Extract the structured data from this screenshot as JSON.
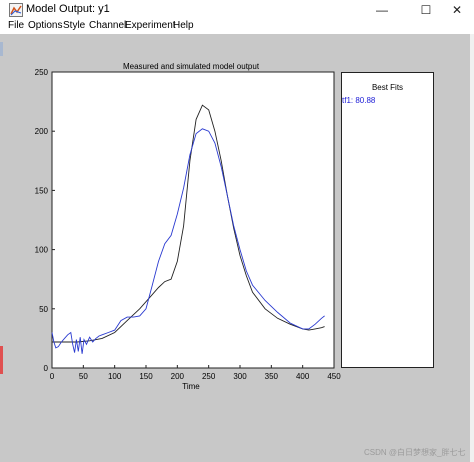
{
  "window": {
    "title": "Model Output: y1",
    "controls": {
      "minimize": "—",
      "maximize": "☐",
      "close": "✕"
    }
  },
  "menu": [
    "File",
    "Options",
    "Style",
    "Channel",
    "Experiment",
    "Help"
  ],
  "chart_data": {
    "type": "line",
    "title": "Measured and simulated model output",
    "xlabel": "Time",
    "ylabel": "",
    "xlim": [
      0,
      450
    ],
    "ylim": [
      0,
      250
    ],
    "xticks": [
      0,
      50,
      100,
      150,
      200,
      250,
      300,
      350,
      400,
      450
    ],
    "yticks": [
      0,
      50,
      100,
      150,
      200,
      250
    ],
    "grid": false,
    "series": [
      {
        "color": "#222222",
        "x": [
          0,
          20,
          40,
          60,
          80,
          100,
          120,
          140,
          160,
          170,
          180,
          190,
          200,
          210,
          220,
          230,
          240,
          250,
          260,
          270,
          280,
          290,
          300,
          310,
          320,
          340,
          360,
          380,
          400,
          410,
          420,
          430,
          435
        ],
        "y": [
          22,
          22,
          22,
          23,
          25,
          30,
          40,
          50,
          62,
          68,
          73,
          75,
          90,
          120,
          175,
          210,
          222,
          218,
          200,
          175,
          145,
          118,
          95,
          78,
          64,
          50,
          42,
          37,
          33,
          32,
          33,
          34,
          35
        ]
      },
      {
        "color": "#2a3ad0",
        "x": [
          0,
          3,
          6,
          10,
          15,
          20,
          25,
          30,
          33,
          36,
          39,
          42,
          45,
          48,
          51,
          55,
          60,
          65,
          70,
          75,
          80,
          90,
          100,
          110,
          120,
          130,
          140,
          150,
          160,
          170,
          180,
          190,
          200,
          210,
          220,
          230,
          240,
          250,
          260,
          270,
          280,
          290,
          300,
          310,
          320,
          340,
          360,
          380,
          400,
          410,
          420,
          430,
          435
        ],
        "y": [
          30,
          22,
          17,
          18,
          22,
          25,
          28,
          30,
          20,
          13,
          24,
          14,
          26,
          12,
          24,
          20,
          26,
          22,
          25,
          27,
          28,
          30,
          32,
          40,
          43,
          43,
          44,
          50,
          70,
          90,
          105,
          112,
          130,
          152,
          180,
          198,
          202,
          200,
          190,
          170,
          145,
          120,
          100,
          82,
          70,
          57,
          47,
          38,
          33,
          33,
          37,
          42,
          44
        ]
      }
    ]
  },
  "best_fits": {
    "title": "Best Fits",
    "entries": [
      "tf1: 80.88"
    ]
  },
  "watermark": "CSDN @白日梦想家_胖七七"
}
